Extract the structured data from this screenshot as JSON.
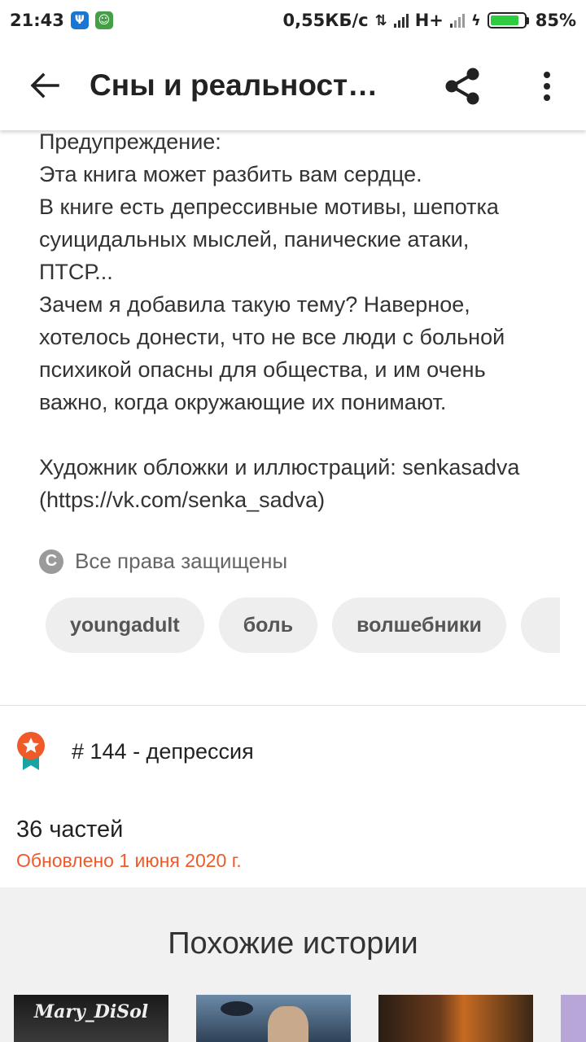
{
  "status_bar": {
    "time": "21:43",
    "network_speed": "0,55КБ/с",
    "network_type": "H+",
    "battery_percent": "85%",
    "battery_level": 0.85,
    "app_icons": [
      "trident-icon",
      "frog-icon"
    ]
  },
  "app_bar": {
    "title": "Сны и реальност…"
  },
  "description": {
    "lines": [
      "Предупреждение:",
      "Эта книга может разбить вам сердце.",
      "В книге есть депрессивные мотивы, шепотка",
      "суицидальных мыслей, панические атаки,",
      "ПТСР...",
      "Зачем я добавила такую тему? Наверное,",
      "хотелось донести, что не все люди с больной",
      "психикой опасны для общества, и им очень",
      "важно, когда окружающие их понимают.",
      "",
      "Художник обложки и иллюстраций: senkasadva",
      "(https://vk.com/senka_sadva)"
    ]
  },
  "copyright": {
    "label": "Все права защищены"
  },
  "tags": [
    "youngadult",
    "боль",
    "волшебники",
    ""
  ],
  "ranking": {
    "text": "# 144 - депрессия"
  },
  "story_info": {
    "parts": "36 частей",
    "updated": "Обновлено 1 июня 2020 г."
  },
  "similar": {
    "title": "Похожие истории",
    "covers": [
      {
        "author_text": "Mary_DiSol"
      },
      {
        "author_text": ""
      },
      {
        "author_text": ""
      },
      {
        "author_text": ""
      }
    ]
  },
  "colors": {
    "accent_orange": "#f05a28",
    "badge_teal": "#1aa3a3",
    "tag_bg": "#eeeeee",
    "similar_bg": "#f1f1f1"
  }
}
